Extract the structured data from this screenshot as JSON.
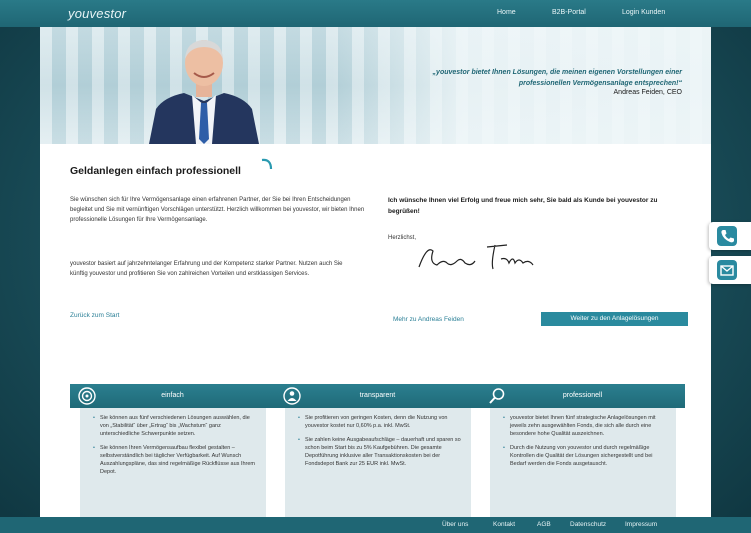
{
  "header": {
    "logo": "youvestor",
    "nav": [
      "Home",
      "B2B-Portal",
      "Login Kunden"
    ]
  },
  "hero": {
    "quote": "„youvestor bietet Ihnen Lösungen, die meinen eigenen Vorstellungen einer professionellen Vermögensanlage entsprechen!“",
    "author": "Andreas Feiden, CEO"
  },
  "main": {
    "title": "Geldanlegen einfach professionell",
    "paragraph1": "Sie wünschen sich für Ihre Vermögensanlage einen erfahrenen Partner, der Sie bei Ihren Entscheidungen begleitet und Sie mit vernünftigen Vorschlägen unterstützt. Herzlich willkommen bei youvestor, wir bieten Ihnen professionelle Lösungen für Ihre Vermögensanlage.",
    "paragraph2": "youvestor basiert auf jahrzehntelanger Erfahrung und der Kompetenz starker Partner. Nutzen auch Sie künftig youvestor und profitieren Sie von zahlreichen Vorteilen und erstklassigen Services.",
    "back_link": "Zurück zum Start",
    "greeting": "Ich wünsche Ihnen viel Erfolg und freue mich sehr, Sie bald als Kunde bei youvestor zu begrüßen!",
    "sincerely": "Herzlichst,",
    "more_link": "Mehr zu Andreas Feiden",
    "cta": "Weiter zu den Anlagelösungen"
  },
  "features": [
    {
      "title": "einfach",
      "icon": "target-icon",
      "bullets": [
        "Sie können aus fünf verschiedenen Lösungen auswählen, die von „Stabilität“ über „Ertrag“ bis „Wachstum“ ganz unterschiedliche Schwerpunkte setzen.",
        "Sie können Ihren Vermögensaufbau flexibel gestalten – selbstverständlich bei täglicher Verfügbarkeit. Auf Wunsch Auszahlungspläne, das sind regelmäßige Rückflüsse aus Ihrem Depot."
      ]
    },
    {
      "title": "transparent",
      "icon": "people-icon",
      "bullets": [
        "Sie profitieren von geringen Kosten, denn die Nutzung von youvestor kostet nur 0,60% p.a. inkl. MwSt.",
        "Sie zahlen keine Ausgabeaufschläge – dauerhaft und sparen so schon beim Start bis zu 5% Kaufgebühren. Die gesamte Depotführung inklusive aller Transaktionskosten bei der Fondsdepot Bank zur 25 EUR inkl. MwSt."
      ]
    },
    {
      "title": "professionell",
      "icon": "search-icon",
      "bullets": [
        "youvestor bietet Ihnen fünf strategische Anlagelösungen mit jeweils zehn ausgewählten Fonds, die sich alle durch eine besondere hohe Qualität auszeichnen.",
        "Durch die Nutzung von youvestor und durch regelmäßige Kontrollen die Qualität der Lösungen sichergestellt und bei Bedarf werden die Fonds ausgetauscht."
      ]
    }
  ],
  "side_buttons": [
    "phone-icon",
    "mail-icon"
  ],
  "footer": [
    "Über uns",
    "Kontakt",
    "AGB",
    "Datenschutz",
    "Impressum"
  ],
  "colors": {
    "accent": "#2a8a9e",
    "dark": "#1f6674"
  }
}
